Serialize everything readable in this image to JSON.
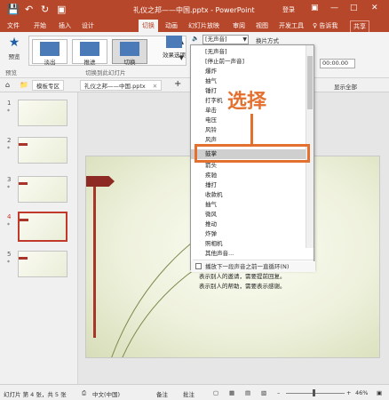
{
  "titlebar": {
    "undo_icon": "undo-icon",
    "redo_icon": "redo-icon",
    "doc_title": "礼仪之邦——中国.pptx  -  PowerPoint",
    "login": "登录",
    "bg_color": "#b7472a"
  },
  "tabs": [
    "文件",
    "开始",
    "插入",
    "设计",
    "切换",
    "动画",
    "幻灯片放映",
    "审阅",
    "视图",
    "开发工具"
  ],
  "active_tab": "切换",
  "tell_me": "♀ 告诉我",
  "share": "共享",
  "ribbon": {
    "preview_label": "预览",
    "group_preview": "预览",
    "effects": [
      "淡出",
      "推进",
      "切换"
    ],
    "effect_options": "效果选项",
    "group_transition": "切换到此幻灯片",
    "sound_value": "[无声音]",
    "switch_mode_label": "换片方式",
    "time_value": "00:00.00"
  },
  "doctabs": {
    "tab1": "模板专区",
    "tab2": "礼仪之邦——中国.pptx",
    "display_all": "显示全部"
  },
  "slides": [
    {
      "num": "1",
      "star": "*"
    },
    {
      "num": "2",
      "star": "*"
    },
    {
      "num": "3",
      "star": "*"
    },
    {
      "num": "4",
      "star": "*"
    },
    {
      "num": "5",
      "star": "*"
    }
  ],
  "sound_list": [
    "[无声音]",
    "[停止前一声音]",
    "爆炸",
    "抽气",
    "锤打",
    "打字机",
    "单击",
    "电压",
    "风铃",
    "风声",
    "",
    "鼓掌",
    "箭头",
    "疾驰",
    "捶打",
    "收款机",
    "抽气",
    "微风",
    "推动",
    "炸弹",
    "照相机",
    "其他声音..."
  ],
  "highlight_item": "鼓掌",
  "loop_option": "播放下一段声音之前一直循环(N)",
  "annotation": "选择",
  "slide_bullets": [
    "表示别人的邀请，需要提前回复。",
    "表示别人的帮助，需要表示感谢。"
  ],
  "status": {
    "slide_info": "幻灯片 第 4 张，共 5 张",
    "lang": "中文(中国)",
    "notes": "备注",
    "comments": "批注",
    "zoom": "46%"
  },
  "colors": {
    "accent": "#b7472a",
    "callout": "#e4702f"
  }
}
